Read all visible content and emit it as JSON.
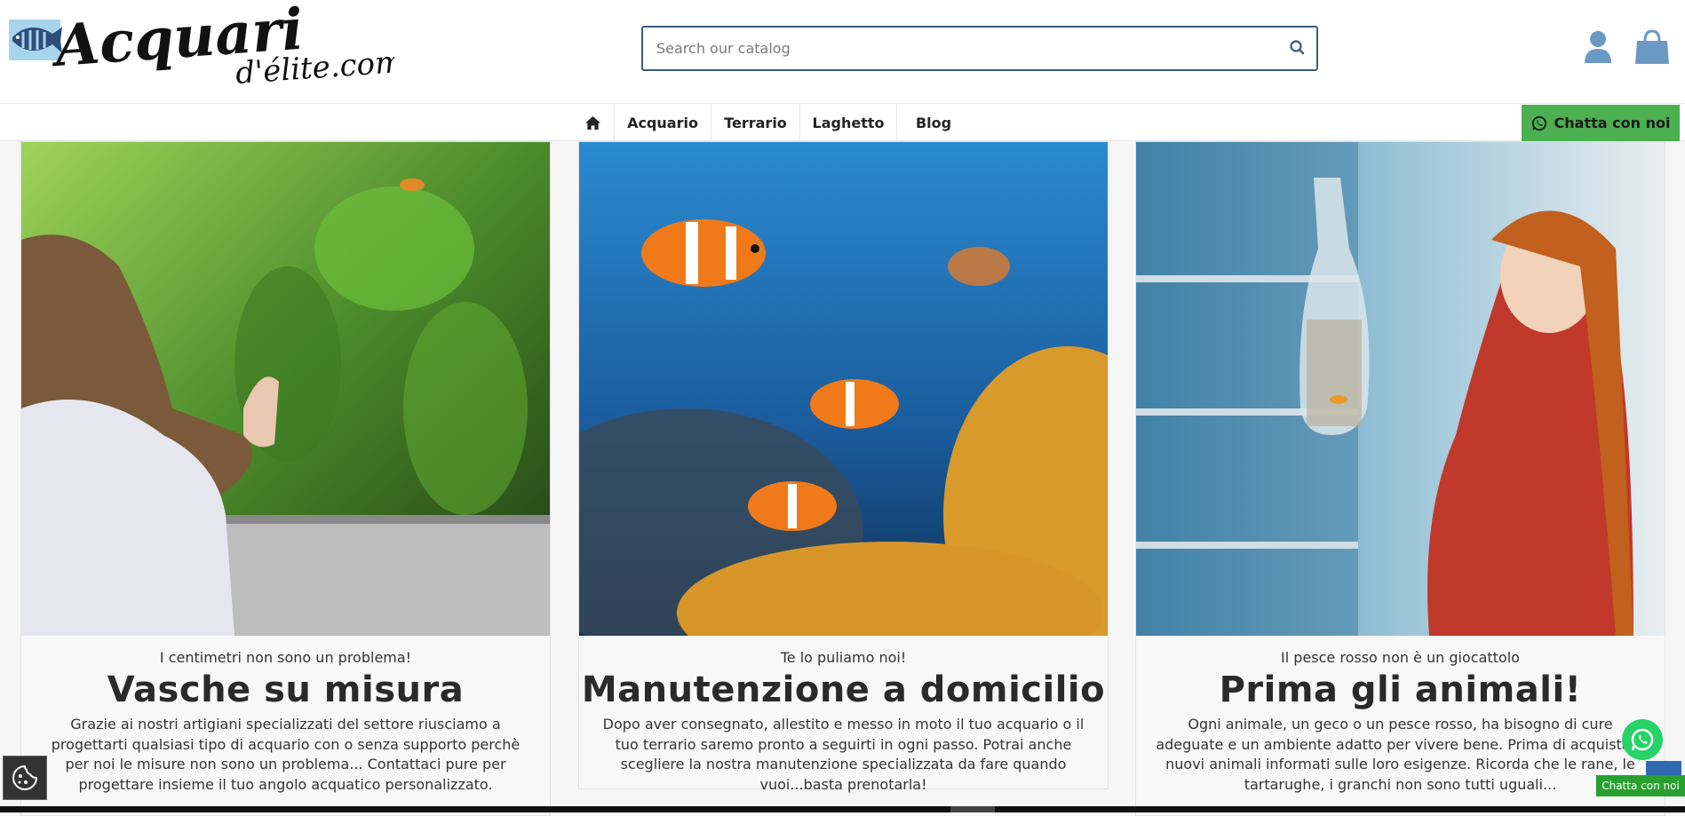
{
  "header": {
    "logo_text": "Acquari d'élite.com",
    "search_placeholder": "Search our catalog"
  },
  "nav": {
    "items": [
      {
        "label": "Acquario"
      },
      {
        "label": "Terrario"
      },
      {
        "label": "Laghetto"
      },
      {
        "label": "Blog"
      }
    ],
    "chat_label": "Chatta con noi"
  },
  "cards": [
    {
      "subtitle": "I centimetri non sono un problema!",
      "title": "Vasche su misura",
      "text": "Grazie ai nostri artigiani specializzati del settore riusciamo a progettarti qualsiasi tipo di acquario con o senza supporto perchè per noi le misure non sono un problema... Contattaci pure per progettare insieme il tuo angolo acquatico personalizzato."
    },
    {
      "subtitle": "Te lo puliamo noi!",
      "title": "Manutenzione a domicilio",
      "text": "Dopo aver consegnato, allestito e messo in moto il tuo acquario o il tuo terrario saremo pronto a seguirti in ogni passo. Potrai anche scegliere la nostra manutenzione specializzata da fare quando vuoi...basta prenotarla!"
    },
    {
      "subtitle": "Il pesce rosso non è un giocattolo",
      "title": "Prima gli animali!",
      "text": "Ogni animale, un geco o un pesce rosso, ha bisogno di cure adeguate e un ambiente adatto per vivere bene. Prima di acquistare nuovi animali informati sulle loro esigenze. Ricorda che le rane, le tartarughe, i granchi non sono tutti uguali..."
    }
  ],
  "floating": {
    "chat_mini_label": "Chatta con noi"
  },
  "colors": {
    "accent_green": "#4caf50",
    "search_border": "#3b5c7e",
    "icon_blue": "#6a9ac4"
  }
}
